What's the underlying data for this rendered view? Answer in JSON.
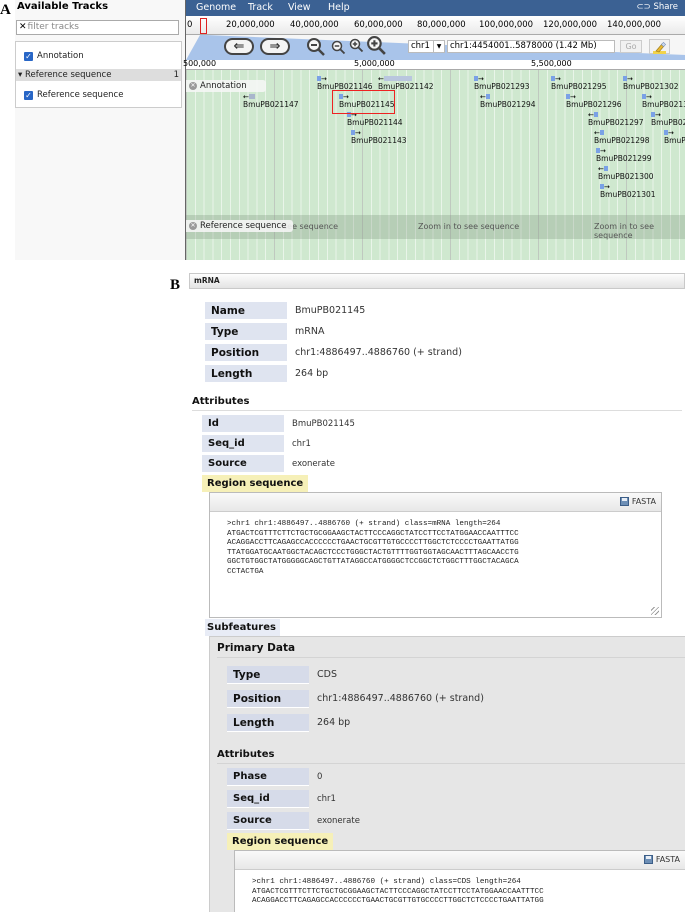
{
  "panel_labels": {
    "a": "A",
    "b": "B"
  },
  "track_list": {
    "title": "Available Tracks",
    "filter_placeholder": "filter tracks",
    "filter_icon": "x-icon",
    "items": [
      {
        "label": "Annotation",
        "checked": true
      }
    ],
    "categories": [
      {
        "label": "Reference sequence",
        "count": "1",
        "collapsed": false,
        "items": [
          {
            "label": "Reference sequence",
            "checked": true
          }
        ]
      }
    ]
  },
  "browser": {
    "menu": [
      "Genome",
      "Track",
      "View",
      "Help"
    ],
    "share_label": "Share",
    "share_icon": "link-icon",
    "overview_ticks": [
      "0",
      "20,000,000",
      "40,000,000",
      "60,000,000",
      "80,000,000",
      "100,000,000",
      "120,000,000",
      "140,000,000"
    ],
    "nav": {
      "pan_left_icon": "arrow-left-icon",
      "pan_right_icon": "arrow-right-icon",
      "zoom_out_big_icon": "zoom-out-icon",
      "zoom_out_small_icon": "zoom-out-small-icon",
      "zoom_in_small_icon": "zoom-in-small-icon",
      "zoom_in_big_icon": "zoom-in-icon",
      "ref_seq": "chr1",
      "location": "chr1:4454001..5878000 (1.42 Mb)",
      "go_label": "Go",
      "highlight_icon": "highlighter-icon"
    },
    "detail_ticks": [
      "500,000",
      "5,000,000",
      "5,500,000"
    ],
    "tracks": {
      "annotation_label": "Annotation",
      "reference_label": "Reference sequence",
      "zoom_message": "Zoom in to see sequence",
      "partial_message": "see sequence"
    },
    "features": [
      {
        "name": "BmuPB021146",
        "strand": "+"
      },
      {
        "name": "BmuPB021142",
        "strand": "-"
      },
      {
        "name": "BmuPB021147",
        "strand": "-"
      },
      {
        "name": "BmuPB021145",
        "strand": "+",
        "selected": true
      },
      {
        "name": "BmuPB021144",
        "strand": "+"
      },
      {
        "name": "BmuPB021143",
        "strand": "+"
      },
      {
        "name": "BmuPB021293",
        "strand": "+"
      },
      {
        "name": "BmuPB021294",
        "strand": "-"
      },
      {
        "name": "BmuPB021295",
        "strand": "+"
      },
      {
        "name": "BmuPB021296",
        "strand": "+"
      },
      {
        "name": "BmuPB021297",
        "strand": "-"
      },
      {
        "name": "BmuPB021298",
        "strand": "-"
      },
      {
        "name": "BmuPB021299",
        "strand": "+"
      },
      {
        "name": "BmuPB021300",
        "strand": "-"
      },
      {
        "name": "BmuPB021301",
        "strand": "+"
      },
      {
        "name": "BmuPB021302",
        "strand": "+"
      },
      {
        "name": "BmuPB0213",
        "strand": "+"
      },
      {
        "name": "BmuPB02",
        "strand": "+"
      },
      {
        "name": "BmuP",
        "strand": "+"
      }
    ]
  },
  "detail": {
    "dialog_title": "mRNA",
    "primary": [
      {
        "name": "Name",
        "value": "BmuPB021145"
      },
      {
        "name": "Type",
        "value": "mRNA"
      },
      {
        "name": "Position",
        "value": "chr1:4886497..4886760 (+ strand)"
      },
      {
        "name": "Length",
        "value": "264 bp"
      }
    ],
    "attributes_title": "Attributes",
    "attributes": [
      {
        "name": "Id",
        "value": "BmuPB021145"
      },
      {
        "name": "Seq_id",
        "value": "chr1"
      },
      {
        "name": "Source",
        "value": "exonerate"
      }
    ],
    "region_sequence_label": "Region sequence",
    "fasta_label": "FASTA",
    "sequence": ">chr1 chr1:4886497..4886760 (+ strand) class=mRNA length=264\nATGACTCGTTTCTTCTGCTGCGGAAGCTACTTCCCAGGCTATCCTTCCTATGGAACCAATTTCC\nACAGGACCTTCAGAGCCACCCCCCTGAACTGCGTTGTGCCCCTTGGCTCTCCCCTGAATTATGG\nTTATGGATGCAATGGCTACAGCTCCCTGGGCTACTGTTTTGGTGGTAGCAACTTTAGCAACCTG\nGGCTGTGGCTATGGGGGCAGCTGTTATAGGCCATGGGGCTCCGGCTCTGGCTTTGGCTACAGCA\nCCTACTGA",
    "subfeatures_label": "Subfeatures",
    "subfeature": {
      "primary_title": "Primary Data",
      "primary": [
        {
          "name": "Type",
          "value": "CDS"
        },
        {
          "name": "Position",
          "value": "chr1:4886497..4886760 (+ strand)"
        },
        {
          "name": "Length",
          "value": "264 bp"
        }
      ],
      "attributes_title": "Attributes",
      "attributes": [
        {
          "name": "Phase",
          "value": "0"
        },
        {
          "name": "Seq_id",
          "value": "chr1"
        },
        {
          "name": "Source",
          "value": "exonerate"
        }
      ],
      "region_sequence_label": "Region sequence",
      "fasta_label": "FASTA",
      "sequence": ">chr1 chr1:4886497..4886760 (+ strand) class=CDS length=264\nATGACTCGTTTCTTCTGCTGCGGAAGCTACTTCCCAGGCTATCCTTCCTATGGAACCAATTTCC\nACAGGACCTTCAGAGCCACCCCCCTGAACTGCGTTGTGCCCCTTGGCTCTCCCCTGAATTATGG"
    }
  }
}
